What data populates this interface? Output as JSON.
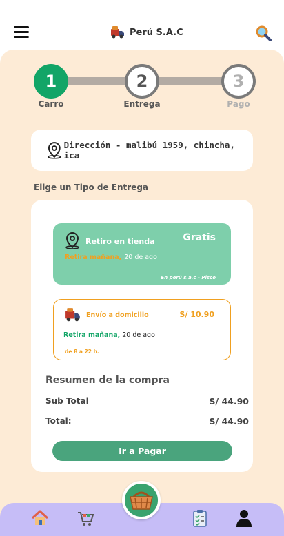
{
  "header": {
    "title": "Perú S.A.C",
    "menu_icon": "hamburger-icon",
    "brand_icon": "delivery-truck-icon",
    "search_icon": "search-magnifier-icon"
  },
  "stepper": {
    "steps": [
      {
        "number": "1",
        "label": "Carro",
        "state": "active"
      },
      {
        "number": "2",
        "label": "Entrega",
        "state": "idle"
      },
      {
        "number": "3",
        "label": "Pago",
        "state": "disabled"
      }
    ]
  },
  "address": {
    "text": "Dirección - malibú 1959, chincha, ica",
    "icon": "location-pin-icon"
  },
  "delivery": {
    "section_title": "Elige un Tipo de Entrega",
    "options": [
      {
        "name": "Retiro en tienda",
        "price": "Gratis",
        "when_label": "Retira mañana,",
        "when_date": "20 de ago",
        "location": "En perú s.a.c - Pisco",
        "selected": true
      },
      {
        "name": "Envío a domicilio",
        "price": "S/ 10.90",
        "when_label": "Retira mañana,",
        "when_date": "20 de ago",
        "hours": "de 8 a 22 h.",
        "selected": false
      }
    ]
  },
  "summary": {
    "title": "Resumen de la compra",
    "subtotal_label": "Sub Total",
    "subtotal_value": "S/ 44.90",
    "total_label": "Total:",
    "total_value": "S/ 44.90"
  },
  "actions": {
    "pay_label": "Ir a Pagar"
  },
  "bottom_nav": {
    "items": [
      "home-icon",
      "shopping-cart-icon",
      "basket-icon",
      "checklist-icon",
      "user-icon"
    ]
  },
  "colors": {
    "accent_green": "#12a567",
    "store_card": "#7ecfab",
    "orange": "#f0a020",
    "panel_bg": "#fdebd6",
    "nav_bg": "#c6bdf7"
  }
}
